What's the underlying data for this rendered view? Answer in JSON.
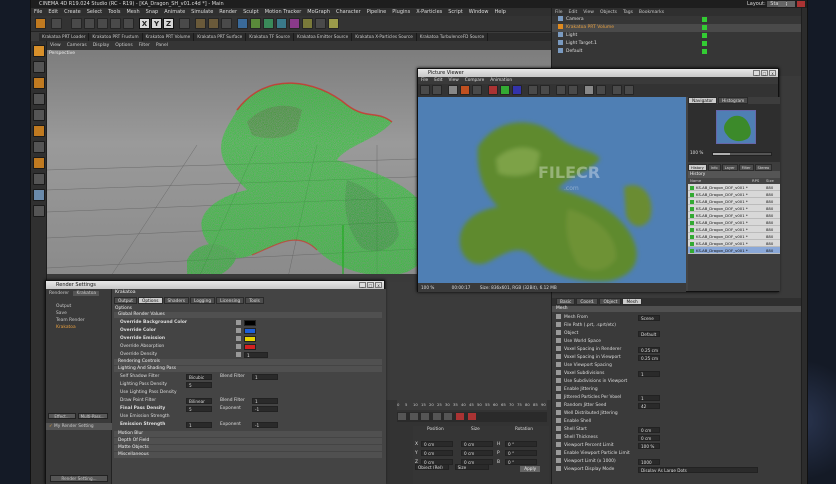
{
  "app": {
    "title": "CINEMA 4D R19.024 Studio (RC - R19) - [KA_Dragon_SH_v01.c4d *] - Main",
    "layout_label": "Layout:",
    "layout_value": "Startup",
    "menu": [
      "File",
      "Edit",
      "Create",
      "Select",
      "Tools",
      "Mesh",
      "Snap",
      "Animate",
      "Simulate",
      "Render",
      "Sculpt",
      "Motion Tracker",
      "MoGraph",
      "Character",
      "Pipeline",
      "Plugins",
      "X-Particles",
      "Script",
      "Window",
      "Help"
    ],
    "plugin_tabs": [
      "Krakatoa PRT Loader",
      "Krakatoa PRT Frustum",
      "Krakatoa PRT Volume",
      "Krakatoa PRT Surface",
      "Krakatoa TF Source",
      "Krakatoa Emitter Source",
      "Krakatoa X-Particles Source",
      "Krakatoa TurbulenceFD Source"
    ],
    "xyz": [
      "X",
      "Y",
      "Z"
    ],
    "viewport_menu": [
      "View",
      "Cameras",
      "Display",
      "Options",
      "Filter",
      "Panel"
    ],
    "viewport_label": "Perspective",
    "watermark": "FILECR",
    "watermark_sub": ".com"
  },
  "object_manager": {
    "menu": [
      "File",
      "Edit",
      "View",
      "Objects",
      "Tags",
      "Bookmarks"
    ],
    "items": [
      "Camera",
      "Krakatoa PRT Volume",
      "Light",
      "Light Target.1",
      "Default"
    ]
  },
  "attributes": {
    "tabs": [
      "Basic",
      "Coord.",
      "Object",
      "Mesh"
    ],
    "active_tab": "Mesh",
    "section": "Mesh",
    "rows": [
      {
        "label": "Mesh From",
        "value": "Scene"
      },
      {
        "label": "File Path (.prt, .sprt/etc)",
        "value": ""
      },
      {
        "label": "Object",
        "value": "Default"
      },
      {
        "label": "Use World Space",
        "value": ""
      },
      {
        "label": "Voxel Spacing in Renderer",
        "value": "0.25 cm"
      },
      {
        "label": "Voxel Spacing in Viewport",
        "value": "0.25 cm"
      },
      {
        "label": "Use Viewport Spacing",
        "value": ""
      },
      {
        "label": "Voxel Subdivisions",
        "value": "1"
      },
      {
        "label": "Use Subdivisions in Viewport",
        "value": ""
      },
      {
        "label": "Enable Jittering",
        "value": ""
      },
      {
        "label": "Jittered Particles Per Voxel",
        "value": "1"
      },
      {
        "label": "Random Jitter Seed",
        "value": "42"
      },
      {
        "label": "Well Distributed Jittering",
        "value": ""
      },
      {
        "label": "Enable Shell",
        "value": ""
      },
      {
        "label": "Shell Start",
        "value": "0 cm"
      },
      {
        "label": "Shell Thickness",
        "value": "0 cm"
      },
      {
        "label": "Viewport Percent Limit",
        "value": "100 %"
      },
      {
        "label": "Enable Viewport Particle Limit",
        "value": ""
      },
      {
        "label": "Viewport Limit (x 1000)",
        "value": "1000"
      },
      {
        "label": "Viewport Display Mode",
        "value": "Display As Large Dots"
      }
    ]
  },
  "picture_viewer": {
    "title": "Picture Viewer",
    "menu": [
      "File",
      "Edit",
      "View",
      "Compare",
      "Animation"
    ],
    "tabs": [
      "Navigator",
      "Histogram"
    ],
    "zoom": "100 %",
    "history_tabs": [
      "History",
      "Info",
      "Layer",
      "Filter",
      "Stereo"
    ],
    "history_header": "History",
    "col_name": "Name",
    "col_rps": "RPS",
    "col_size": "Size",
    "history_items": [
      "KS-AB_Dragon_DOF_v001 *",
      "KS-AB_Dragon_DOF_v001 *",
      "KS-AB_Dragon_DOF_v001 *",
      "KS-AB_Dragon_DOF_v001 *",
      "KS-AB_Dragon_DOF_v001 *",
      "KS-AB_Dragon_DOF_v001 *",
      "KS-AB_Dragon_DOF_v001 *",
      "KS-AB_Dragon_DOF_v001 *",
      "KS-AB_Dragon_DOF_v001 *",
      "KS-AB_Dragon_DOF_v001 *"
    ],
    "history_size": "880",
    "status_zoom": "100 %",
    "status_time": "00:00:17",
    "status_info": "Size: 836x601, RGB (32Bit), 6.12 MB"
  },
  "render_settings": {
    "title": "Render Settings",
    "renderer_label": "Renderer",
    "renderer_value": "Krakatoa",
    "left_items": [
      "Output",
      "Save",
      "Team Render",
      "Krakatoa"
    ],
    "buttons": [
      "Effect...",
      "Multi-Pass..."
    ],
    "setting_name": "My Render Setting",
    "bottom_button": "Render Setting...",
    "panel_title": "Krakatoa",
    "tabs": [
      "Output",
      "Options",
      "Shaders",
      "Logging",
      "Licensing",
      "Tools"
    ],
    "active_tab": "Options",
    "options_header": "Options",
    "sections": {
      "global": "Global Render Values",
      "rendering": "Rendering Controls",
      "lighting": "Lighting And Shading Pass",
      "motion": "Motion Blur",
      "dof": "Depth Of Field",
      "matte": "Matte Objects",
      "misc": "Miscellaneous"
    },
    "global_rows": [
      {
        "label": "Override Background Color",
        "color": "#000000"
      },
      {
        "label": "Override Color",
        "color": "#1e5fd8"
      },
      {
        "label": "Override Emission",
        "color": "#e8d400"
      },
      {
        "label": "Override Absorption",
        "color": "#d42020"
      },
      {
        "label": "Override Density",
        "value": "1"
      }
    ],
    "light_rows": [
      {
        "label": "Self Shadow Filter",
        "value": "Bicubic",
        "extra_label": "Blend Filter",
        "extra": "1"
      },
      {
        "label": "Lighting Pass Density",
        "value": "5"
      },
      {
        "label": "Use Lighting Pass Density",
        "value": ""
      },
      {
        "label": "Draw Point Filter",
        "value": "Bilinear",
        "extra_label": "Blend Filter",
        "extra": "1"
      },
      {
        "label": "Final Pass Density",
        "value": "5",
        "extra_label": "Exponent",
        "extra": "-1"
      },
      {
        "label": "Use Emission Strength",
        "value": ""
      },
      {
        "label": "Emission Strength",
        "value": "1",
        "extra_label": "Exponent",
        "extra": "-1"
      }
    ]
  },
  "coords": {
    "headers": [
      "Position",
      "Size",
      "Rotation"
    ],
    "rows": [
      {
        "axis": "X",
        "pos": "0 cm",
        "size": "0 cm",
        "rot_axis": "H",
        "rot": "0 °"
      },
      {
        "axis": "Y",
        "pos": "0 cm",
        "size": "0 cm",
        "rot_axis": "P",
        "rot": "0 °"
      },
      {
        "axis": "Z",
        "pos": "0 cm",
        "size": "0 cm",
        "rot_axis": "B",
        "rot": "0 °"
      }
    ],
    "mode1": "Object (Rel)",
    "mode2": "Size",
    "apply": "Apply"
  },
  "timeline": {
    "ticks": [
      "0",
      "5",
      "10",
      "15",
      "20",
      "25",
      "30",
      "35",
      "40",
      "45",
      "50",
      "55",
      "60",
      "65",
      "70",
      "75",
      "80",
      "85",
      "90"
    ],
    "frame": "0 F",
    "start": "0 F",
    "end": "90 F"
  },
  "colors": {
    "dragon_green": "#22d12a",
    "viewer_bg": "#4f7fb4",
    "accent": "#e08a1e"
  }
}
